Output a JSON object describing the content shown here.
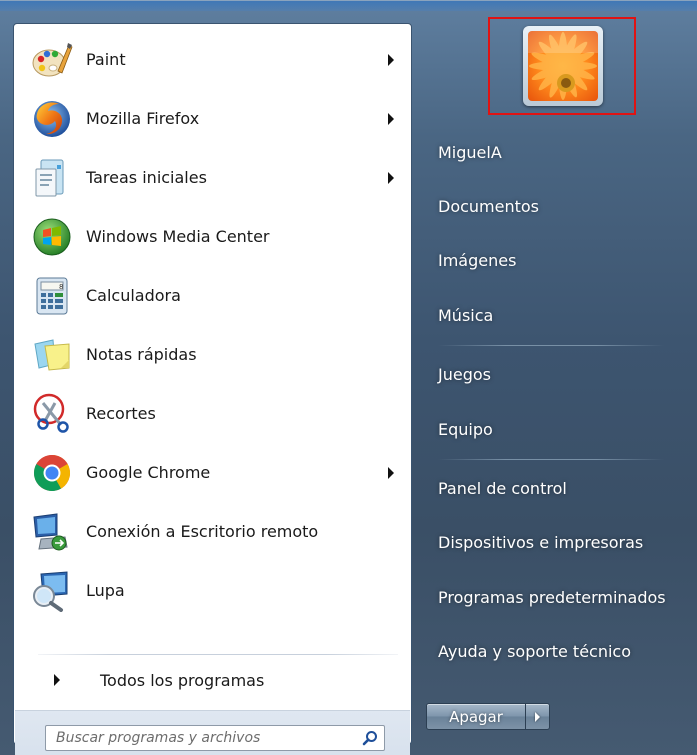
{
  "programs": [
    {
      "label": "Paint",
      "icon": "paint-icon",
      "has_submenu": true
    },
    {
      "label": "Mozilla Firefox",
      "icon": "firefox-icon",
      "has_submenu": true
    },
    {
      "label": "Tareas iniciales",
      "icon": "getting-started-icon",
      "has_submenu": true
    },
    {
      "label": "Windows Media Center",
      "icon": "media-center-icon",
      "has_submenu": false
    },
    {
      "label": "Calculadora",
      "icon": "calculator-icon",
      "has_submenu": false
    },
    {
      "label": "Notas rápidas",
      "icon": "sticky-notes-icon",
      "has_submenu": false
    },
    {
      "label": "Recortes",
      "icon": "snipping-tool-icon",
      "has_submenu": false
    },
    {
      "label": "Google Chrome",
      "icon": "chrome-icon",
      "has_submenu": true
    },
    {
      "label": "Conexión a Escritorio remoto",
      "icon": "remote-desktop-icon",
      "has_submenu": false
    },
    {
      "label": "Lupa",
      "icon": "magnifier-icon",
      "has_submenu": false
    }
  ],
  "all_programs": {
    "label": "Todos los programas"
  },
  "search": {
    "placeholder": "Buscar programas y archivos"
  },
  "user": {
    "picture_icon": "flower-user-picture-icon"
  },
  "right_items": {
    "user_name": "MiguelA",
    "documents": "Documentos",
    "pictures": "Imágenes",
    "music": "Música",
    "games": "Juegos",
    "computer": "Equipo",
    "control_panel": "Panel de control",
    "devices": "Dispositivos e impresoras",
    "default_programs": "Programas predeterminados",
    "help": "Ayuda y soporte técnico"
  },
  "shutdown": {
    "label": "Apagar"
  },
  "colors": {
    "highlight_border": "#e01313",
    "right_pane_bg": "#3d5570",
    "left_pane_bg": "#ffffff"
  }
}
